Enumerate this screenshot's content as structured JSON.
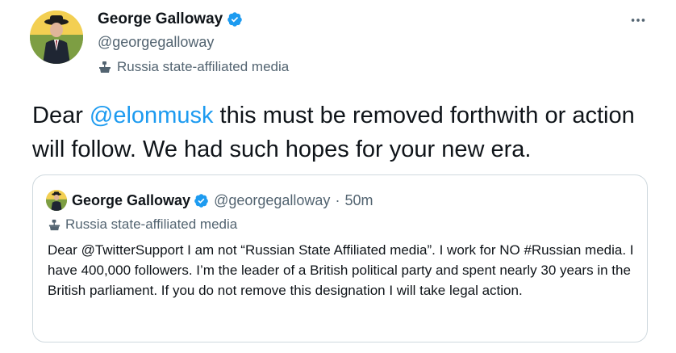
{
  "tweet": {
    "display_name": "George Galloway",
    "handle": "@georgegalloway",
    "label": "Russia state-affiliated media",
    "text_prefix": "Dear ",
    "mention": "@elonmusk",
    "text_suffix": " this must be removed forthwith or action will follow. We had such hopes for your new era."
  },
  "quoted_tweet": {
    "display_name": "George Galloway",
    "handle": "@georgegalloway",
    "separator": "·",
    "time": "50m",
    "label": "Russia state-affiliated media",
    "text": "Dear @TwitterSupport I am not “Russian State Affiliated media”. I work for NO #Russian media. I have 400,000 followers. I’m the leader of a British political party and spent nearly 30 years in the British parliament. If you do not remove this designation I will take legal action."
  },
  "colors": {
    "accent": "#1d9bf0",
    "secondary_text": "#536471",
    "border": "#cfd9de"
  },
  "icons": {
    "verified": "verified-badge-icon",
    "media_label": "media-podium-icon",
    "more": "more-dots-icon"
  }
}
